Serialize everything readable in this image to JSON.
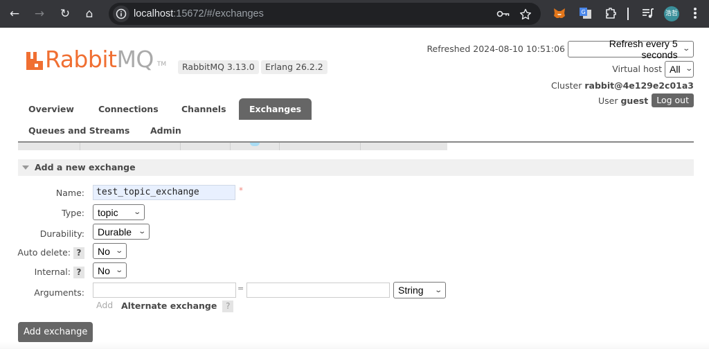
{
  "browser": {
    "url_host": "localhost",
    "url_rest": ":15672/#/exchanges",
    "nav": {
      "back": "←",
      "forward": "→",
      "reload": "↻",
      "home": "⌂"
    },
    "icons": [
      "key-icon",
      "star-icon",
      "metamask-icon",
      "translate-icon",
      "extensions-icon",
      "media-icon"
    ],
    "profile_initials": "浩哲"
  },
  "header": {
    "logo_rabbit": "Rabbit",
    "logo_mq": "MQ",
    "logo_tm": "TM",
    "rabbitmq_version": "RabbitMQ 3.13.0",
    "erlang_version": "Erlang 26.2.2",
    "refreshed_label": "Refreshed 2024-08-10 10:51:06",
    "refresh_select": "Refresh every 5 seconds",
    "virtual_host_label": "Virtual host",
    "virtual_host_select": "All",
    "cluster_label": "Cluster",
    "cluster_name": "rabbit@4e129e2c01a3",
    "user_label": "User",
    "user_name": "guest",
    "logout_label": "Log out"
  },
  "tabs": [
    {
      "label": "Overview",
      "active": false
    },
    {
      "label": "Connections",
      "active": false
    },
    {
      "label": "Channels",
      "active": false
    },
    {
      "label": "Exchanges",
      "active": true
    },
    {
      "label": "Queues and Streams",
      "active": false
    },
    {
      "label": "Admin",
      "active": false
    }
  ],
  "section": {
    "title": "Add a new exchange",
    "form": {
      "name_label": "Name:",
      "name_value": "test_topic_exchange",
      "required_mark": "*",
      "type_label": "Type:",
      "type_value": "topic",
      "durability_label": "Durability:",
      "durability_value": "Durable",
      "auto_delete_label": "Auto delete:",
      "auto_delete_value": "No",
      "internal_label": "Internal:",
      "internal_value": "No",
      "help_mark": "?",
      "arguments_label": "Arguments:",
      "arguments_key": "",
      "arguments_equals": "=",
      "arguments_value": "",
      "arguments_type": "String",
      "add_link": "Add",
      "alternate_exchange": "Alternate exchange"
    },
    "submit_label": "Add exchange"
  }
}
